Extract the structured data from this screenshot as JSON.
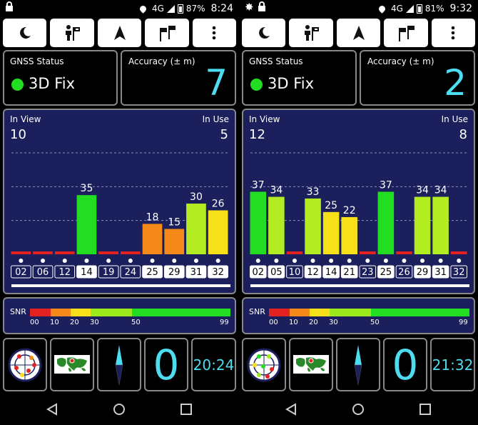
{
  "screens": [
    {
      "status_bar": {
        "network": "4G",
        "battery": "87%",
        "time": "8:24"
      },
      "gnss_status_label": "GNSS Status",
      "fix_text": "3D Fix",
      "accuracy_label": "Accuracy (± m)",
      "accuracy_value": "7",
      "in_view_label": "In View",
      "in_view_value": "10",
      "in_use_label": "In Use",
      "in_use_value": "5",
      "chart_data": {
        "type": "bar",
        "categories": [
          "02",
          "06",
          "12",
          "14",
          "19",
          "24",
          "25",
          "29",
          "31",
          "32"
        ],
        "values": [
          0,
          0,
          0,
          35,
          0,
          0,
          18,
          15,
          30,
          26
        ],
        "value_labels": [
          "",
          "",
          "",
          "35",
          "",
          "",
          "18",
          "15",
          "30",
          "26"
        ],
        "in_use": [
          false,
          false,
          false,
          true,
          false,
          false,
          true,
          true,
          true,
          true
        ],
        "ylim": [
          0,
          60
        ]
      },
      "time_value": "20:24",
      "zero_value": "0"
    },
    {
      "status_bar": {
        "network": "4G",
        "battery": "81%",
        "time": "9:32"
      },
      "gnss_status_label": "GNSS Status",
      "fix_text": "3D Fix",
      "accuracy_label": "Accuracy (± m)",
      "accuracy_value": "2",
      "in_view_label": "In View",
      "in_view_value": "12",
      "in_use_label": "In Use",
      "in_use_value": "8",
      "chart_data": {
        "type": "bar",
        "categories": [
          "02",
          "05",
          "10",
          "12",
          "14",
          "21",
          "23",
          "25",
          "26",
          "29",
          "31",
          "32"
        ],
        "values": [
          37,
          34,
          0,
          33,
          25,
          22,
          0,
          37,
          0,
          34,
          34,
          0
        ],
        "value_labels": [
          "37",
          "34",
          "",
          "33",
          "25",
          "22",
          "",
          "37",
          "",
          "34",
          "34",
          ""
        ],
        "in_use": [
          true,
          true,
          false,
          true,
          true,
          true,
          false,
          true,
          false,
          true,
          true,
          false
        ],
        "ylim": [
          0,
          60
        ]
      },
      "time_value": "21:32",
      "zero_value": "0"
    }
  ],
  "snr_legend": {
    "label": "SNR",
    "ticks": [
      "00",
      "10",
      "20",
      "30",
      "50",
      "99"
    ],
    "colors": [
      "#e52222",
      "#f58a1a",
      "#f5e01a",
      "#9ee81e",
      "#22dd22"
    ]
  },
  "colors": {
    "red": "#e52222",
    "orange": "#f58a1a",
    "yellow": "#f5e01a",
    "yellowgreen": "#b4ec22",
    "green": "#22dd22",
    "accent_cyan": "#4ddcf0",
    "panel_blue": "#1b1f5c"
  },
  "toolbar_icons": [
    "night-mode-icon",
    "person-flag-icon",
    "navigation-arrow-icon",
    "flags-icon",
    "overflow-menu-icon"
  ],
  "bottom_tiles": [
    "radar-icon",
    "world-map-icon",
    "compass-icon",
    "zero-value",
    "time-value"
  ],
  "nav_icons": [
    "back-icon",
    "home-icon",
    "recents-icon"
  ]
}
